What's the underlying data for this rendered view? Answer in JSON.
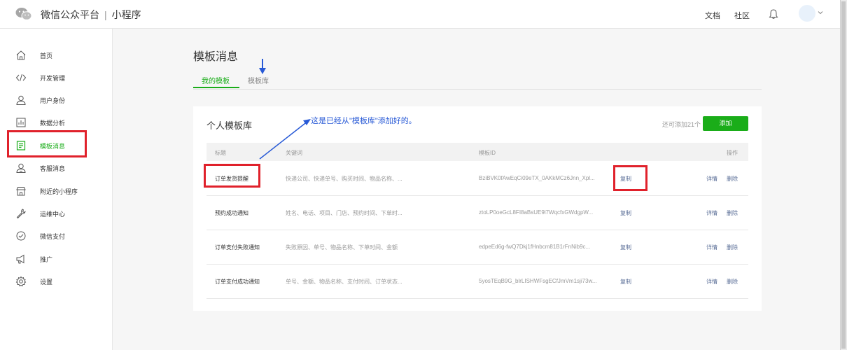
{
  "brand": {
    "name": "微信公众平台",
    "separator": "|",
    "product": "小程序"
  },
  "header": {
    "links": [
      "文档",
      "社区"
    ]
  },
  "sidebar": {
    "items": [
      {
        "label": "首页",
        "icon": "home-icon"
      },
      {
        "label": "开发管理",
        "icon": "code-icon"
      },
      {
        "label": "用户身份",
        "icon": "user-icon"
      },
      {
        "label": "数据分析",
        "icon": "chart-icon"
      },
      {
        "label": "模板消息",
        "icon": "template-icon",
        "active": true
      },
      {
        "label": "客服消息",
        "icon": "service-icon"
      },
      {
        "label": "附近的小程序",
        "icon": "store-icon"
      },
      {
        "label": "运维中心",
        "icon": "wrench-icon"
      },
      {
        "label": "微信支付",
        "icon": "pay-icon"
      },
      {
        "label": "推广",
        "icon": "megaphone-icon"
      },
      {
        "label": "设置",
        "icon": "gear-icon"
      }
    ]
  },
  "main": {
    "title": "模板消息",
    "tabs": [
      {
        "label": "我的模板",
        "active": true
      },
      {
        "label": "模板库"
      }
    ],
    "card": {
      "title": "个人模板库",
      "annotation": "这是已经从\"模板库\"添加好的。",
      "remaining": "还可添加21个",
      "add_label": "添加",
      "columns": [
        "标题",
        "关键词",
        "模板ID",
        "操作"
      ],
      "rows": [
        {
          "title": "订单发货提醒",
          "keywords": "快递公司、快递单号、购买时间、物品名称、...",
          "template_id": "BziBVK0fAwEqCi09eTX_0AKkMCz6Jnn_Xpl...",
          "copy": "复制",
          "detail": "详情",
          "delete": "删除"
        },
        {
          "title": "预约成功通知",
          "keywords": "姓名、电话、项目、门店、预约时间、下单时...",
          "template_id": "ztoLP0oeGcL8FI8aBsUE9l7WqcfxGWdgpW...",
          "copy": "复制",
          "detail": "详情",
          "delete": "删除"
        },
        {
          "title": "订单支付失败通知",
          "keywords": "失败原因、单号、物品名称、下单时间、金额",
          "template_id": "edpeEd6g-fwQ7Dkj1fHnbcm81B1rFnNib9c...",
          "copy": "复制",
          "detail": "详情",
          "delete": "删除"
        },
        {
          "title": "订单支付成功通知",
          "keywords": "单号、金额、物品名称、支付时间、订单状态...",
          "template_id": "5yosTEqB9G_blrLISHWFsgECfJmVm1sji73w...",
          "copy": "复制",
          "detail": "详情",
          "delete": "删除"
        }
      ]
    }
  },
  "colors": {
    "accent": "#1aad19",
    "annotation_red": "#e0212b",
    "annotation_blue": "#2759d6",
    "link": "#576b95"
  }
}
